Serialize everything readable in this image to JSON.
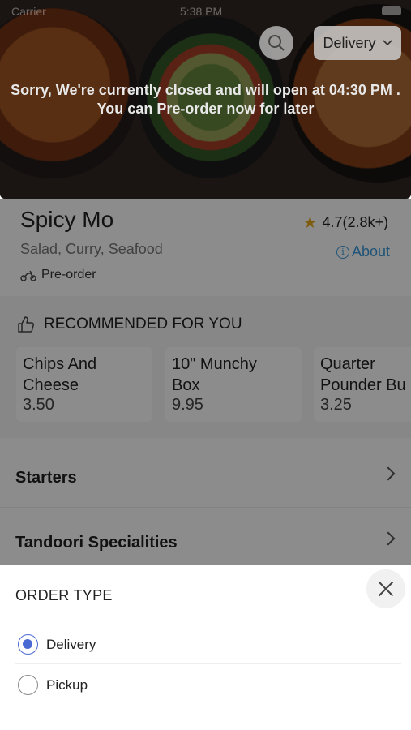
{
  "status": {
    "time": "5:38 PM",
    "carrier": "Carrier"
  },
  "hero": {
    "delivery_label": "Delivery",
    "closed_line1": "Sorry, We're currently closed and will open at 04:30 PM .",
    "closed_line2": "You can Pre-order now for later"
  },
  "restaurant": {
    "name": "Spicy Mo",
    "rating": "4.7(2.8k+)",
    "cuisine": "Salad, Curry, Seafood",
    "about_label": "About",
    "preorder_label": "Pre-order"
  },
  "recommended": {
    "title": "RECOMMENDED FOR YOU",
    "items": [
      {
        "name": "Chips And\nCheese",
        "price": "3.50"
      },
      {
        "name": "10\" Munchy\nBox",
        "price": "9.95"
      },
      {
        "name": "Quarter\nPounder Bu",
        "price": "3.25"
      }
    ]
  },
  "categories": [
    {
      "label": "Starters"
    },
    {
      "label": "Tandoori Specialities"
    }
  ],
  "order_sheet": {
    "title": "ORDER TYPE",
    "options": [
      {
        "label": "Delivery",
        "selected": true
      },
      {
        "label": "Pickup",
        "selected": false
      }
    ]
  },
  "colors": {
    "accent": "#4a6ad3",
    "link": "#3a9ad9",
    "star": "#e6a817"
  }
}
